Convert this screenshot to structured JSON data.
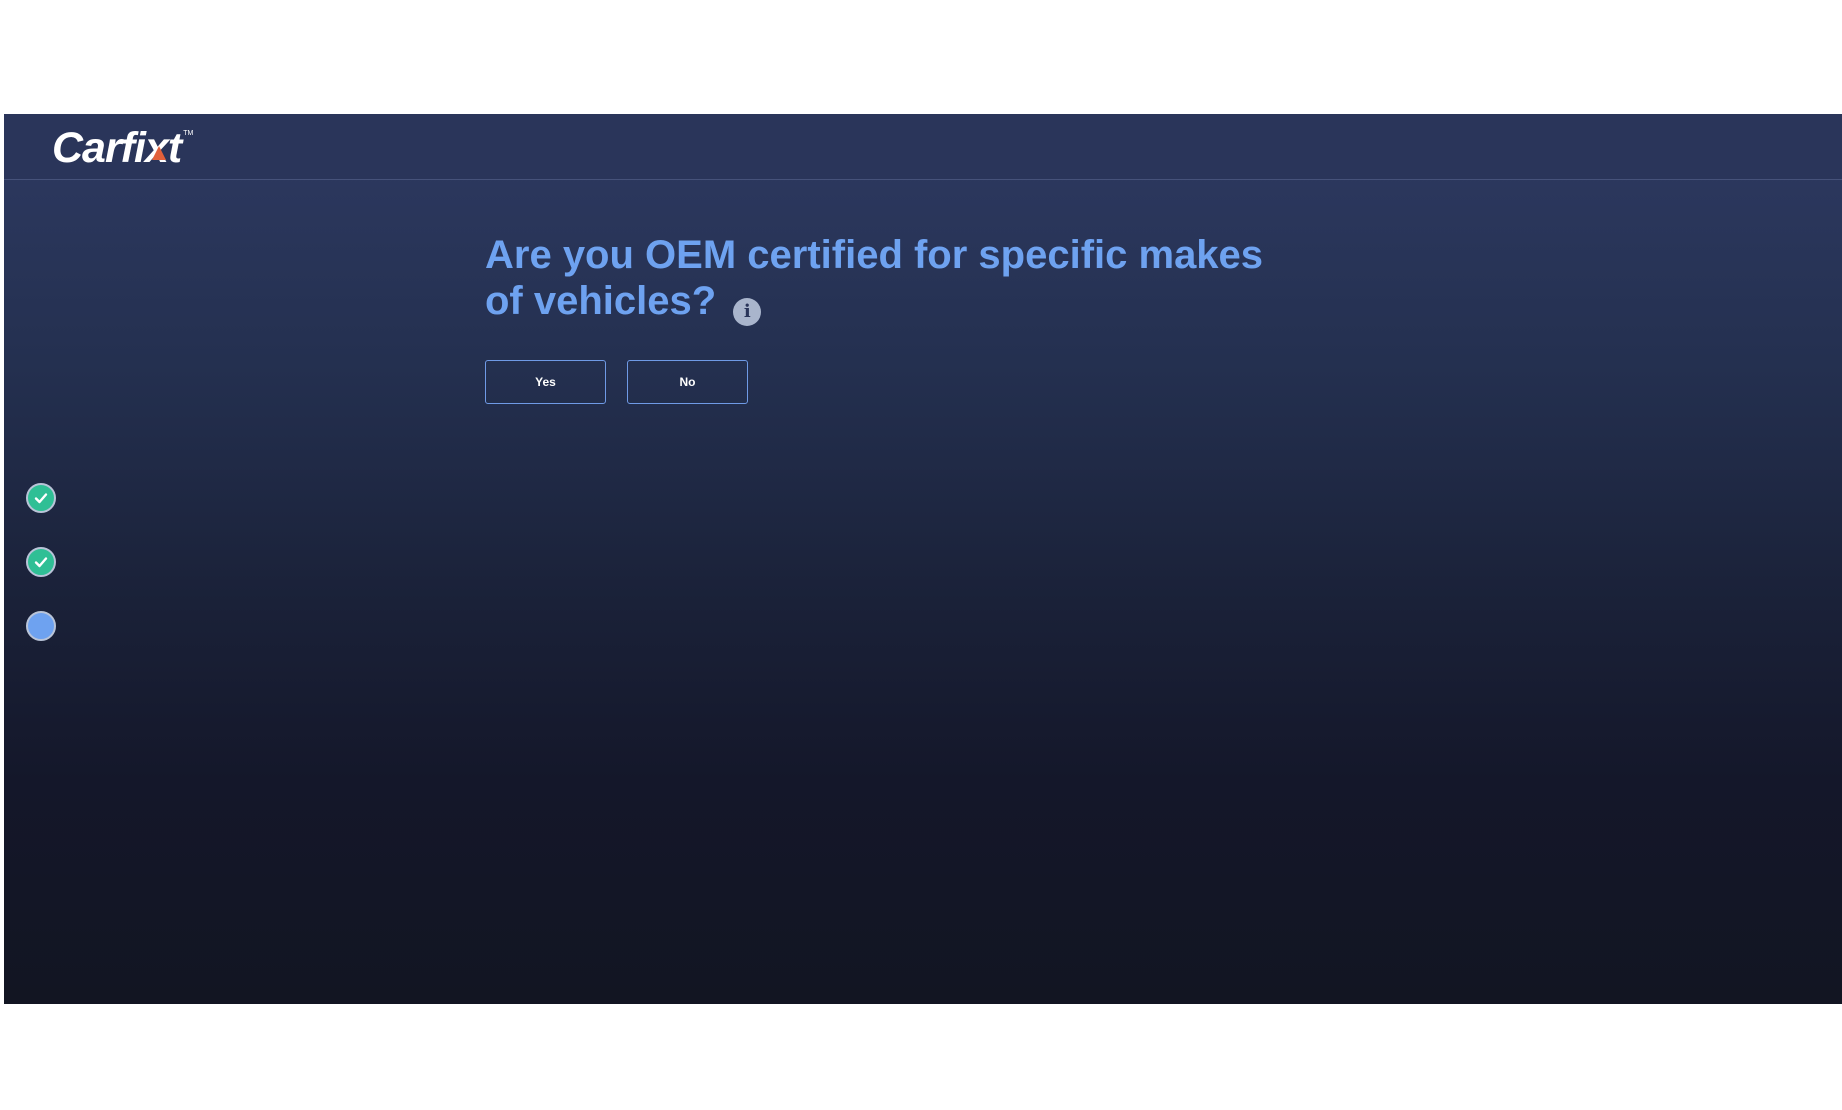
{
  "header": {
    "logo_text": "Carfixt",
    "logo_tm": "TM"
  },
  "question": {
    "text": "Are you OEM certified for specific makes of vehicles?",
    "info_icon": "info-icon"
  },
  "answers": {
    "yes_label": "Yes",
    "no_label": "No"
  },
  "progress": {
    "steps": [
      {
        "status": "complete",
        "icon": "check-icon"
      },
      {
        "status": "complete",
        "icon": "check-icon"
      },
      {
        "status": "current",
        "icon": "dot-icon"
      }
    ]
  },
  "colors": {
    "accent": "#6ea2f0",
    "complete": "#2fbf95",
    "header_bg": "#2a355a"
  }
}
